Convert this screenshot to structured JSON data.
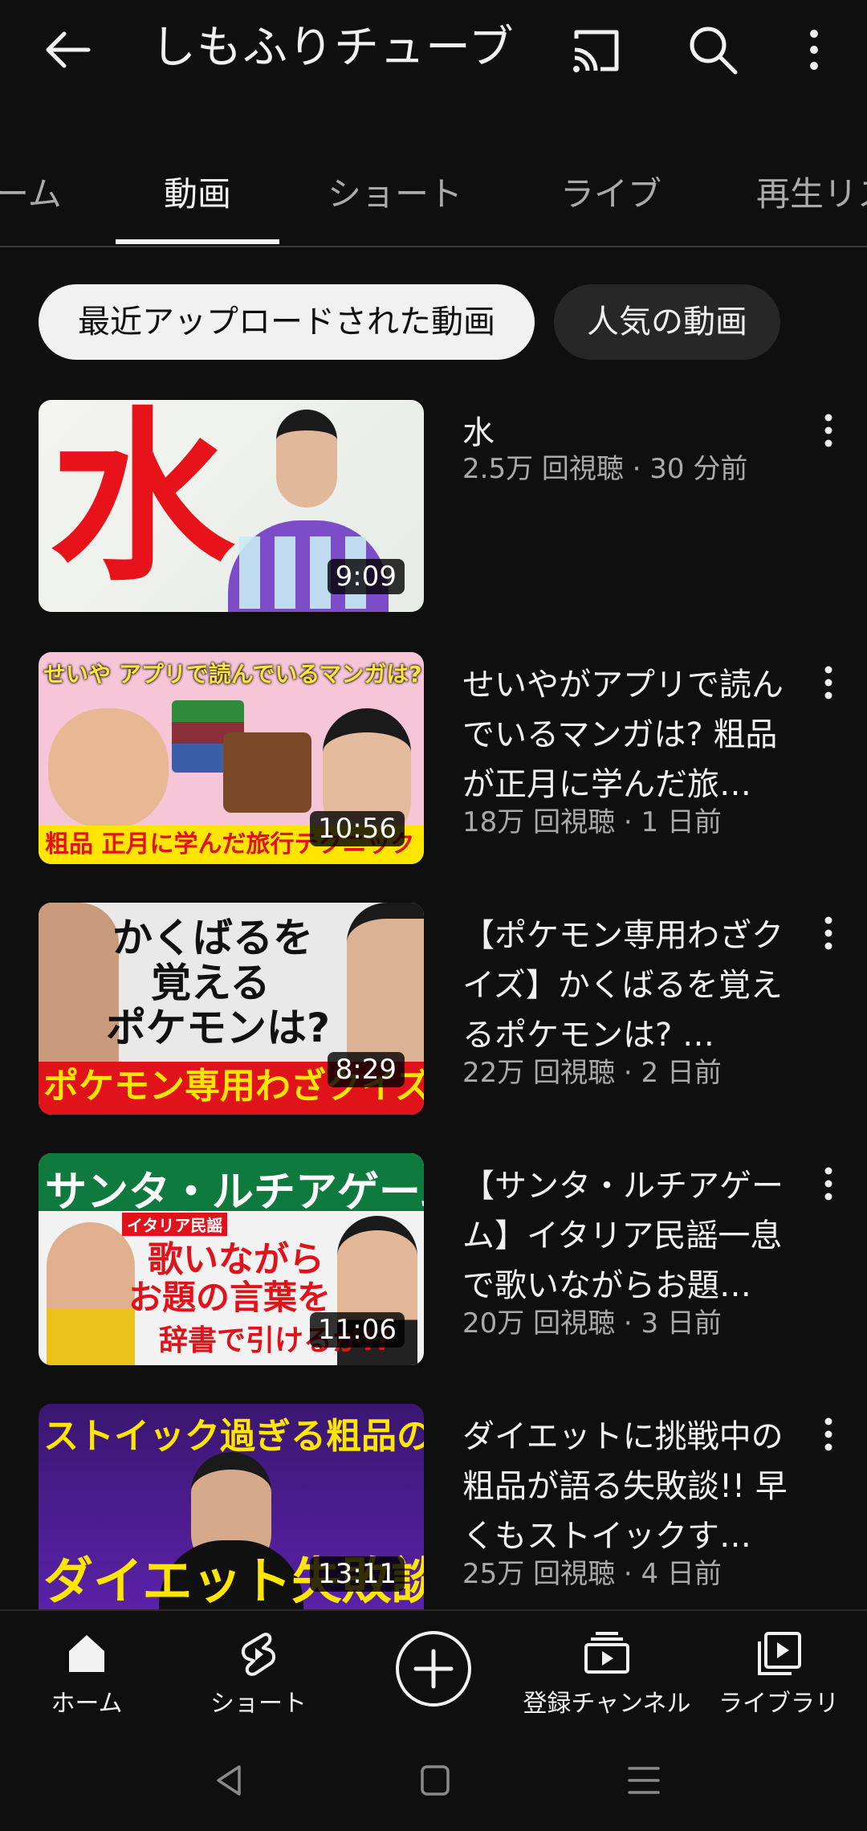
{
  "header": {
    "title": "しもふりチューブ",
    "icons": [
      "back-arrow-icon",
      "cast-icon",
      "search-icon",
      "more-vert-icon"
    ]
  },
  "tabs": [
    {
      "label": "ーム"
    },
    {
      "label": "動画",
      "active": true
    },
    {
      "label": "ショート"
    },
    {
      "label": "ライブ"
    },
    {
      "label": "再生リス"
    }
  ],
  "chips": [
    {
      "label": "最近アップロードされた動画",
      "selected": true
    },
    {
      "label": "人気の動画"
    }
  ],
  "videos": [
    {
      "title": "水",
      "meta": "2.5万 回視聴 · 30 分前",
      "duration": "9:09",
      "thumb_text": [
        "水"
      ]
    },
    {
      "title": "せいやがアプリで読んでいるマンガは? 粗品が正月に学んだ旅…",
      "meta": "18万 回視聴 · 1 日前",
      "duration": "10:56",
      "thumb_text": [
        "せいや アプリで読んでいるマンガは?",
        "粗品 正月に学んだ旅行テクニック"
      ]
    },
    {
      "title": "【ポケモン専用わざクイズ】かくばるを覚えるポケモンは? …",
      "meta": "22万 回視聴 · 2 日前",
      "duration": "8:29",
      "thumb_text": [
        "かくばるを",
        "覚える",
        "ポケモンは?",
        "ポケモン専用わざクイズ"
      ]
    },
    {
      "title": "【サンタ・ルチアゲーム】イタリア民謡一息で歌いながらお題…",
      "meta": "20万 回視聴 · 3 日前",
      "duration": "11:06",
      "thumb_text": [
        "サンタ・ルチアゲーム",
        "イタリア民謡",
        "歌いながら",
        "お題の言葉を",
        "辞書で引けるか!?"
      ]
    },
    {
      "title": "ダイエットに挑戦中の粗品が語る失敗談!! 早くもストイックす…",
      "meta": "25万 回視聴 · 4 日前",
      "duration": "13:11",
      "thumb_text": [
        "ストイック過ぎる粗品の",
        "ダイエット失敗談"
      ]
    }
  ],
  "bottom_nav": [
    {
      "label": "ホーム",
      "icon": "home-icon"
    },
    {
      "label": "ショート",
      "icon": "shorts-icon"
    },
    {
      "label": "",
      "icon": "create-plus-icon"
    },
    {
      "label": "登録チャンネル",
      "icon": "subscriptions-icon"
    },
    {
      "label": "ライブラリ",
      "icon": "library-icon"
    }
  ],
  "colors": {
    "background": "#0f0f0f",
    "text": "#f1f1f1",
    "secondary": "#aaaaaa",
    "chip_selected": "#f1f1f1",
    "chip": "#272727"
  }
}
